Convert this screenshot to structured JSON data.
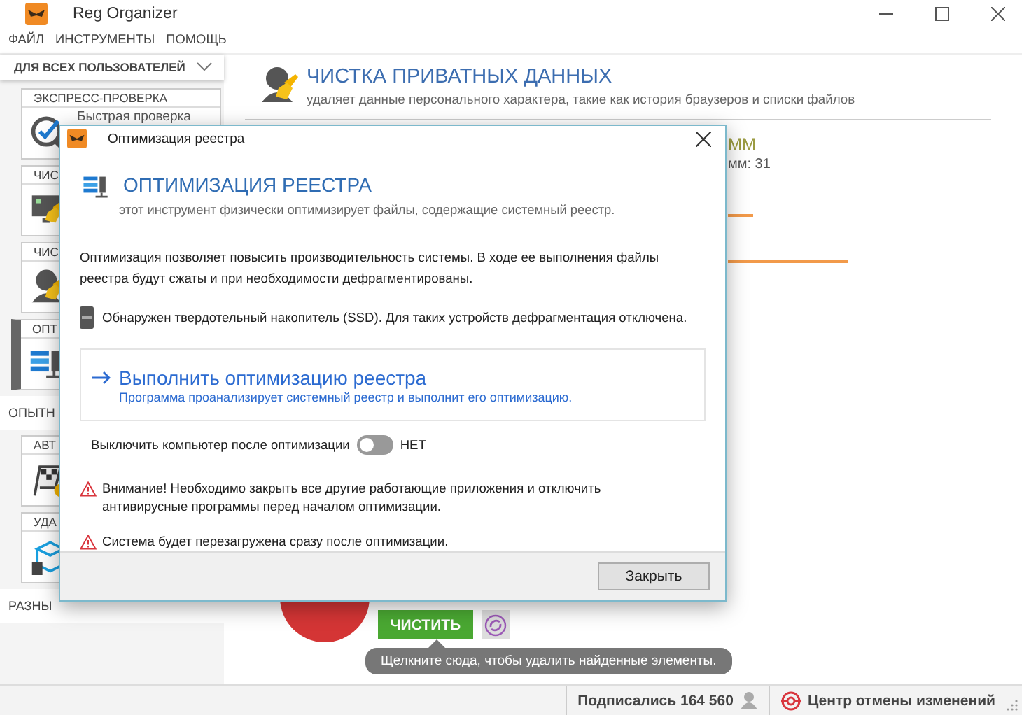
{
  "window": {
    "title": "Reg Organizer"
  },
  "menu": [
    "ФАЙЛ",
    "ИНСТРУМЕНТЫ",
    "ПОМОЩЬ"
  ],
  "sidebar": {
    "scope": "ДЛЯ ВСЕХ ПОЛЬЗОВАТЕЛЕЙ",
    "entries": [
      {
        "kind": "card",
        "title": "ЭКСПРЕСС-ПРОВЕРКА",
        "item": "Быстрая проверка",
        "selected": false
      },
      {
        "kind": "card",
        "title": "ЧИС",
        "selected": false
      },
      {
        "kind": "card",
        "title": "ЧИС",
        "selected": false
      },
      {
        "kind": "card",
        "title": "ОПТ",
        "selected": true
      },
      {
        "kind": "group",
        "title": "ОПЫТН"
      },
      {
        "kind": "card",
        "title": "АВТ",
        "selected": false
      },
      {
        "kind": "card",
        "title": "УДА",
        "selected": false
      },
      {
        "kind": "group",
        "title": "РАЗНЫ"
      }
    ]
  },
  "main": {
    "title": "ЧИСТКА ПРИВАТНЫХ ДАННЫХ",
    "subtitle": "удаляет данные персонального характера, такие как история браузеров и списки файлов",
    "side_panel": {
      "title": "ММ",
      "text": "мм: 31"
    },
    "clean_button": "ЧИСТИТЬ",
    "tooltip": "Щелкните сюда, чтобы удалить найденные элементы."
  },
  "status_bar": {
    "subscribers": "Подписались 164 560",
    "undo_center": "Центр отмены изменений"
  },
  "dialog": {
    "title": "Оптимизация реестра",
    "heading": "ОПТИМИЗАЦИЯ РЕЕСТРА",
    "subtitle": "этот инструмент физически оптимизирует файлы, содержащие системный реестр.",
    "description": "Оптимизация позволяет повысить производительность системы. В ходе ее выполнения файлы реестра будут сжаты и при необходимости дефрагментированы.",
    "ssd_note": "Обнаружен твердотельный накопитель (SSD). Для таких устройств дефрагментация отключена.",
    "action": {
      "title": "Выполнить оптимизацию реестра",
      "description": "Программа проанализирует системный реестр и выполнит его оптимизацию."
    },
    "shutdown": {
      "label": "Выключить компьютер после оптимизации",
      "on": false,
      "value": "НЕТ"
    },
    "warnings": [
      "Внимание! Необходимо закрыть все другие работающие приложения и отключить антивирусные программы перед началом оптимизации.",
      "Система будет перезагружена сразу после оптимизации."
    ],
    "close_button": "Закрыть"
  }
}
